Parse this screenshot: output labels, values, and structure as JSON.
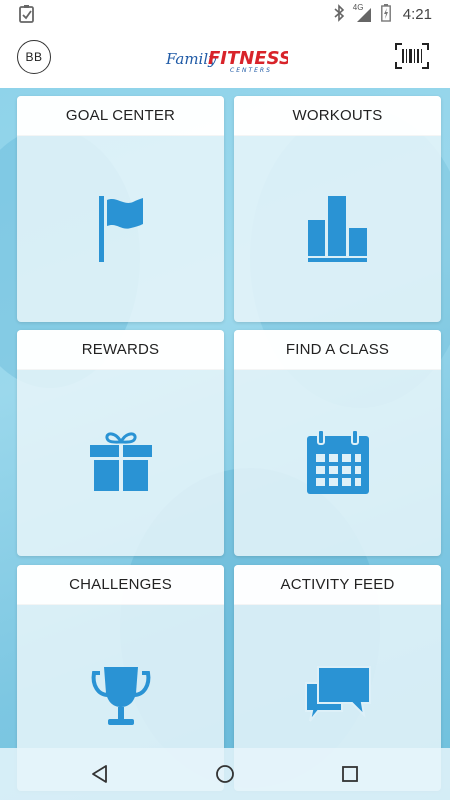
{
  "status_bar": {
    "time": "4:21",
    "network": "4G",
    "icons": [
      "notification-clipboard-icon",
      "bluetooth-icon",
      "signal-icon",
      "battery-icon"
    ]
  },
  "app_bar": {
    "avatar_initials": "BB",
    "logo_text_main": "FITNESS",
    "logo_text_script": "Family",
    "logo_text_sub": "CENTERS",
    "barcode_icon": "barcode-icon"
  },
  "tiles": [
    {
      "label": "GOAL CENTER",
      "icon": "flag-icon"
    },
    {
      "label": "WORKOUTS",
      "icon": "bar-chart-icon"
    },
    {
      "label": "REWARDS",
      "icon": "gift-icon"
    },
    {
      "label": "FIND A CLASS",
      "icon": "calendar-icon"
    },
    {
      "label": "CHALLENGES",
      "icon": "trophy-icon"
    },
    {
      "label": "ACTIVITY FEED",
      "icon": "chat-bubbles-icon"
    }
  ],
  "nav_bar": {
    "icons": [
      "back-icon",
      "home-icon",
      "recents-icon"
    ]
  },
  "colors": {
    "accent": "#2a8fd0",
    "icon_blue": "#3aa0dc",
    "logo_red": "#d8232a",
    "logo_blue": "#1f5aa6"
  }
}
